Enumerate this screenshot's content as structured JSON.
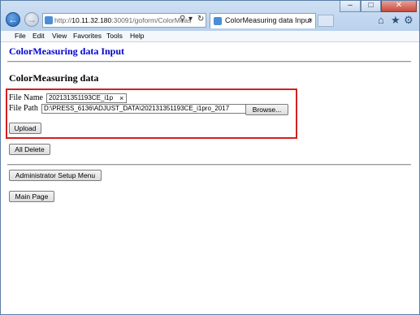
{
  "browser": {
    "address": {
      "prefix": "http://",
      "host": "10.11.32.180",
      "rest": ":30091/goform/ColorMeas"
    },
    "tab": {
      "title": "ColorMeasuring data Input",
      "close": "×"
    },
    "window_controls": {
      "minimize": "–",
      "maximize": "□",
      "close": "✕"
    },
    "right_icons": [
      "home-icon",
      "star-icon",
      "gear-icon"
    ]
  },
  "menu": {
    "items": [
      "File",
      "Edit",
      "View",
      "Favorites",
      "Tools",
      "Help"
    ]
  },
  "page": {
    "heading": "ColorMeasuring data Input",
    "section_title": "ColorMeasuring data",
    "file_name_label": "File Name",
    "file_name_value": "202131351193CE_i1p",
    "file_name_clear": "×",
    "file_path_label": "File Path",
    "file_path_value": "D:\\PRESS_6136\\ADJUST_DATA\\202131351193CE_i1pro_2017",
    "browse_button": "Browse...",
    "upload_button": "Upload",
    "all_delete_button": "All Delete",
    "admin_button": "Administrator Setup Menu",
    "main_page_button": "Main Page"
  },
  "colors": {
    "heading": "#0000cc",
    "highlight_border": "#d42020"
  }
}
